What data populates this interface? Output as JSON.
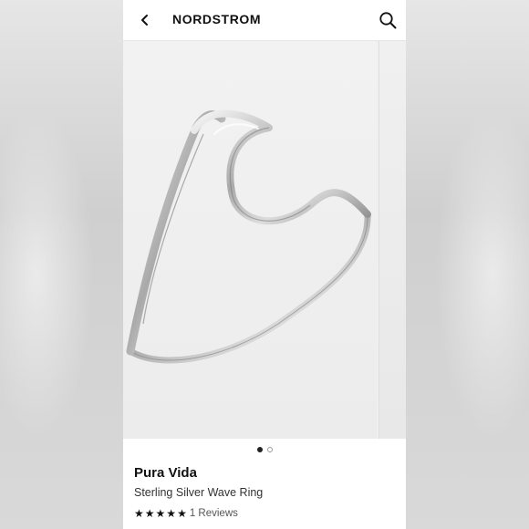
{
  "header": {
    "back_icon": "chevron-left-icon",
    "brand": "NORDSTROM",
    "search_icon": "search-icon"
  },
  "gallery": {
    "total_images": 2,
    "active_index": 1,
    "image_description_icon": "ring-product-image"
  },
  "product": {
    "brand": "Pura Vida",
    "name": "Sterling Silver Wave Ring",
    "rating": 5,
    "rating_max": 5,
    "reviews_label": "1 Reviews"
  },
  "colors": {
    "text_primary": "#111111",
    "background": "#ffffff",
    "gallery_bg": "#efefef"
  }
}
